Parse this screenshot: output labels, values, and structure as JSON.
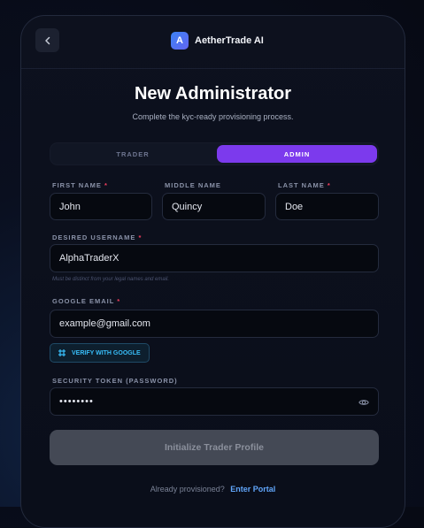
{
  "brand": {
    "logo_letter": "A",
    "name": "AetherTrade AI"
  },
  "header": {
    "back_icon": "chevron-left-icon"
  },
  "page": {
    "title": "New Administrator",
    "subtitle": "Complete the kyc-ready provisioning process."
  },
  "role_toggle": {
    "options": [
      "TRADER",
      "ADMIN"
    ],
    "selected": "ADMIN"
  },
  "fields": {
    "first_name": {
      "label": "FIRST NAME",
      "required": "*",
      "value": "John"
    },
    "middle_name": {
      "label": "MIDDLE NAME",
      "value": "Quincy"
    },
    "last_name": {
      "label": "LAST NAME",
      "required": "*",
      "value": "Doe"
    },
    "username": {
      "label": "DESIRED USERNAME",
      "required": "*",
      "value": "AlphaTraderX",
      "hint": "Must be distinct from your legal names and email."
    },
    "google_email": {
      "label": "GOOGLE EMAIL",
      "required": "*",
      "value": "example@gmail.com"
    },
    "password": {
      "label": "SECURITY TOKEN (PASSWORD)",
      "value": "••••••••"
    }
  },
  "verify_button": {
    "label": "VERIFY WITH GOOGLE",
    "icon": "hash-icon"
  },
  "submit_button": {
    "label": "Initialize Trader Profile"
  },
  "footer": {
    "text": "Already provisioned?",
    "link": "Enter Portal"
  },
  "colors": {
    "accent": "#7c3aed",
    "link": "#60a5fa",
    "required": "#f43f5e",
    "verify": "#38bdf8"
  }
}
